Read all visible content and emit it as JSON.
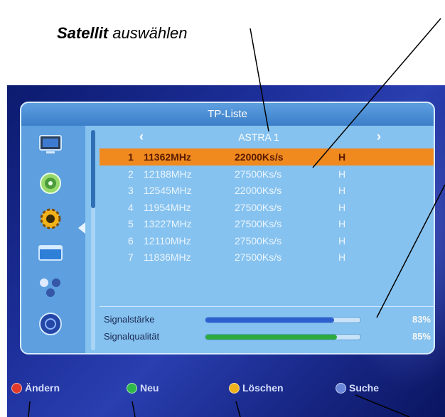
{
  "caption": {
    "bold": "Satellit",
    "rest": " auswählen"
  },
  "panel": {
    "title": "TP-Liste"
  },
  "satellite": {
    "prev": "‹",
    "name": "ASTRA 1",
    "next": "›"
  },
  "transponders": [
    {
      "num": "1",
      "freq": "11362MHz",
      "symbol": "22000Ks/s",
      "pol": "H",
      "selected": true
    },
    {
      "num": "2",
      "freq": "12188MHz",
      "symbol": "27500Ks/s",
      "pol": "H"
    },
    {
      "num": "3",
      "freq": "12545MHz",
      "symbol": "22000Ks/s",
      "pol": "H"
    },
    {
      "num": "4",
      "freq": "11954MHz",
      "symbol": "27500Ks/s",
      "pol": "H"
    },
    {
      "num": "5",
      "freq": "13227MHz",
      "symbol": "27500Ks/s",
      "pol": "H"
    },
    {
      "num": "6",
      "freq": "12110MHz",
      "symbol": "27500Ks/s",
      "pol": "H"
    },
    {
      "num": "7",
      "freq": "11836MHz",
      "symbol": "27500Ks/s",
      "pol": "H"
    }
  ],
  "signal": {
    "strength": {
      "label": "Signalstärke",
      "percent_text": "83%",
      "value": 0.83
    },
    "quality": {
      "label": "Signalqualität",
      "percent_text": "85%",
      "value": 0.85
    }
  },
  "footer": {
    "aendern": "Ändern",
    "neu": "Neu",
    "loeschen": "Löschen",
    "suche": "Suche"
  },
  "colors": {
    "red": "#e23a2a",
    "green": "#2fb84a",
    "yellow": "#f0b21c",
    "blue": "#6a86d8",
    "highlight": "#f08a1f"
  }
}
